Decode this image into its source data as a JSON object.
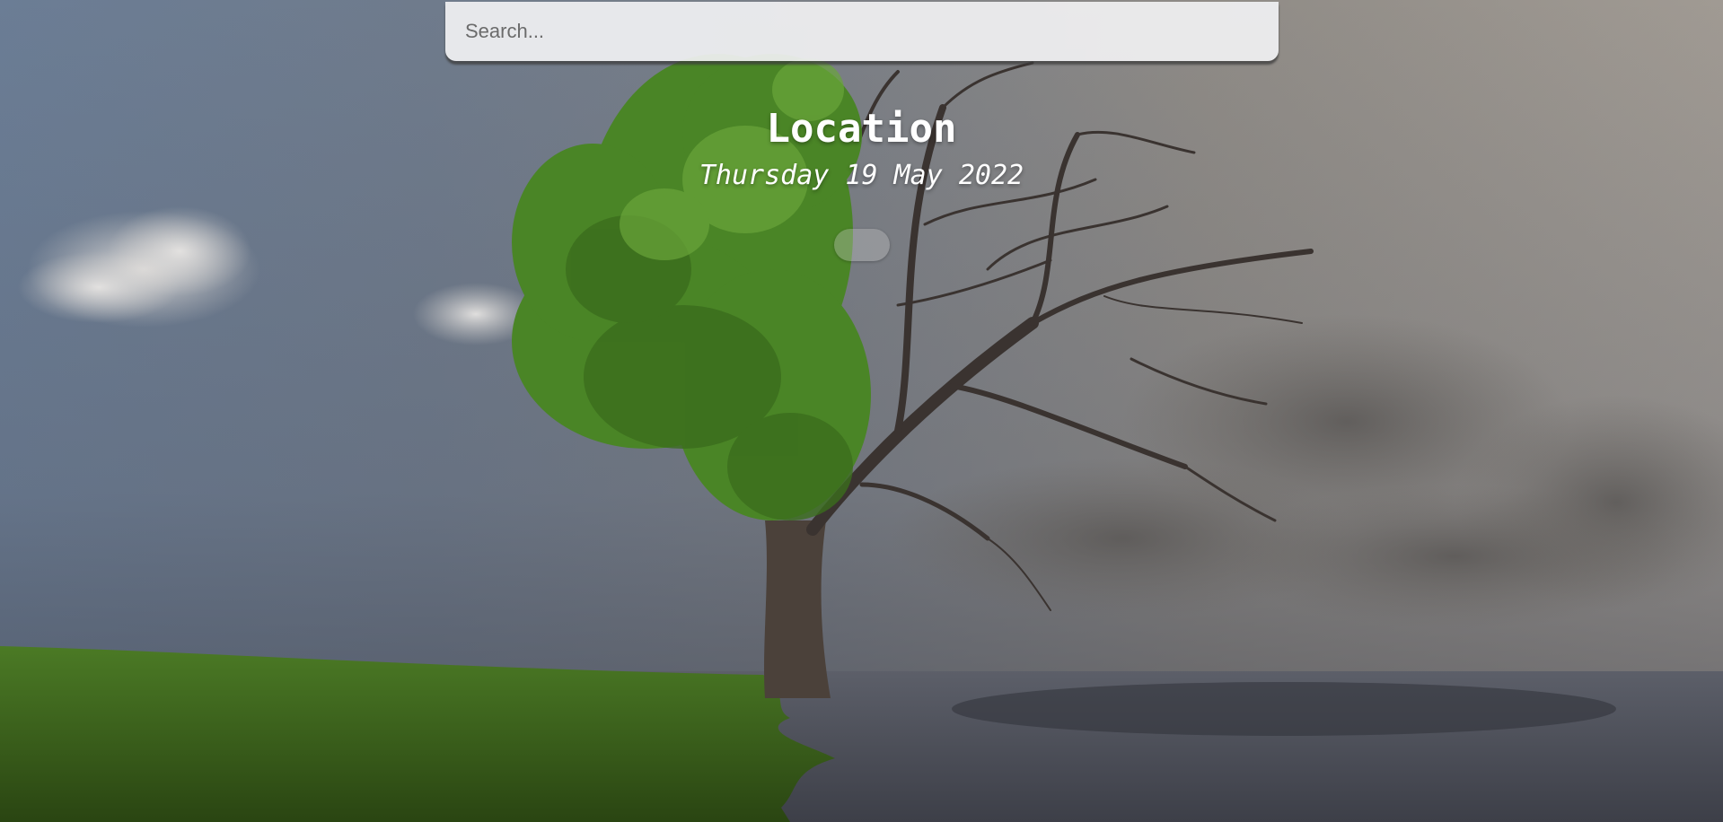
{
  "search": {
    "placeholder": "Search...",
    "value": ""
  },
  "weather": {
    "location": "Location",
    "date": "Thursday 19 May 2022"
  },
  "colors": {
    "sky_left": "#6b7d95",
    "sky_right": "#a09a93",
    "grass": "#3c6a1e",
    "foliage": "#4f8a2a",
    "bare_tree": "#3a3330",
    "text": "#ffffff",
    "search_bg": "#f0f0f2"
  },
  "background": {
    "scene": "split-tree-seasons",
    "icons": [
      "cloud-icon",
      "tree-icon",
      "grass-icon",
      "shadow-icon"
    ]
  }
}
